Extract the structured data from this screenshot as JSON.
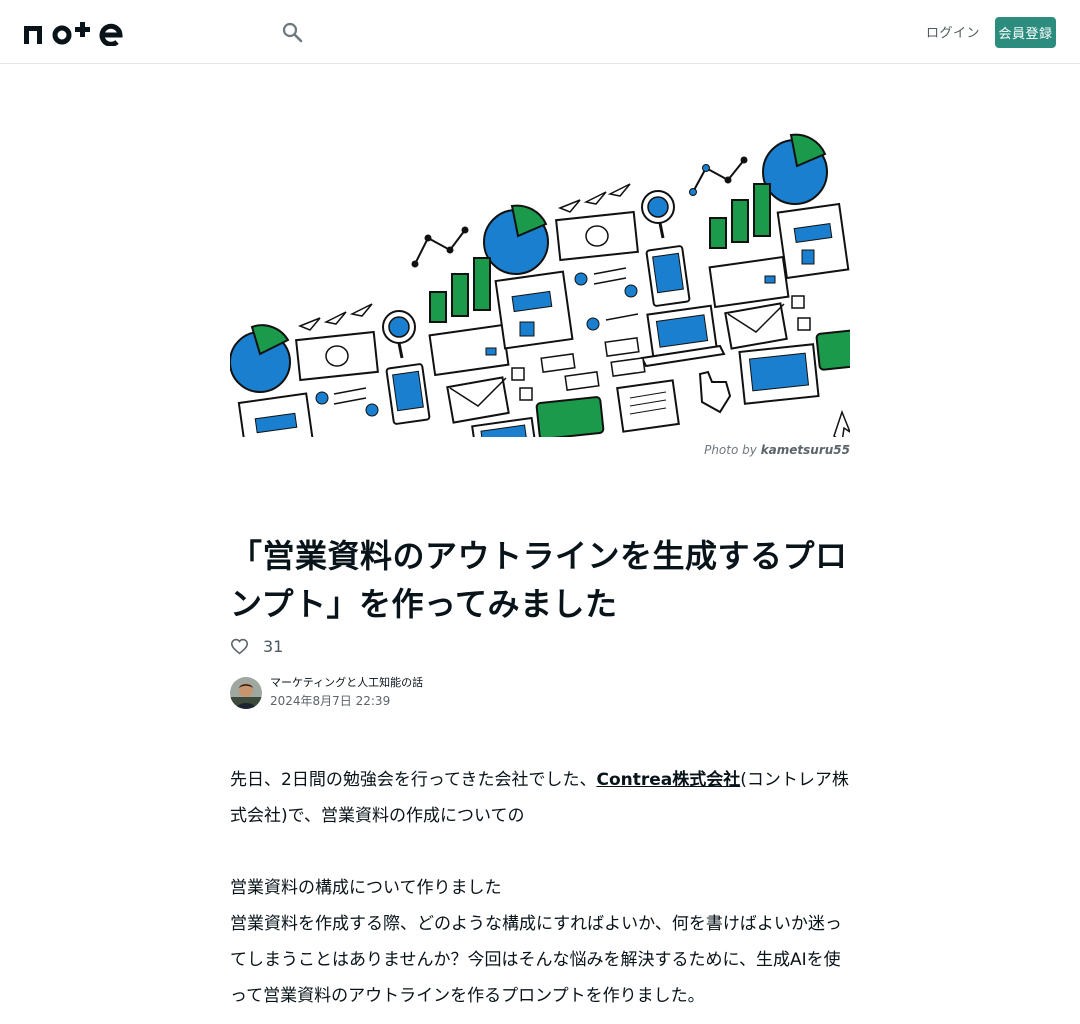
{
  "header": {
    "logo_text": "note",
    "login_label": "ログイン",
    "signup_label": "会員登録"
  },
  "hero": {
    "credit_prefix": "Photo by",
    "credit_author": "kametsuru55"
  },
  "article": {
    "title": "「営業資料のアウトラインを生成するプロンプト」を作ってみました",
    "likes": "31",
    "author_name": "マーケティングと人工知能の話",
    "date": "2024年8月7日 22:39",
    "para1_before": "先日、2日間の勉強会を行ってきた会社でした、",
    "para1_link": "Contrea株式会社",
    "para1_after": "(コントレア株式会社)で、営業資料の作成についての",
    "para2_heading": "営業資料の構成について作りました",
    "para2_text": "営業資料を作成する際、どのような構成にすればよいか、何を書けばよいか迷ってしまうことはありませんか？今回はそんな悩みを解決するために、生成AIを使って営業資料のアウトラインを作るプロンプトを作りました。"
  }
}
